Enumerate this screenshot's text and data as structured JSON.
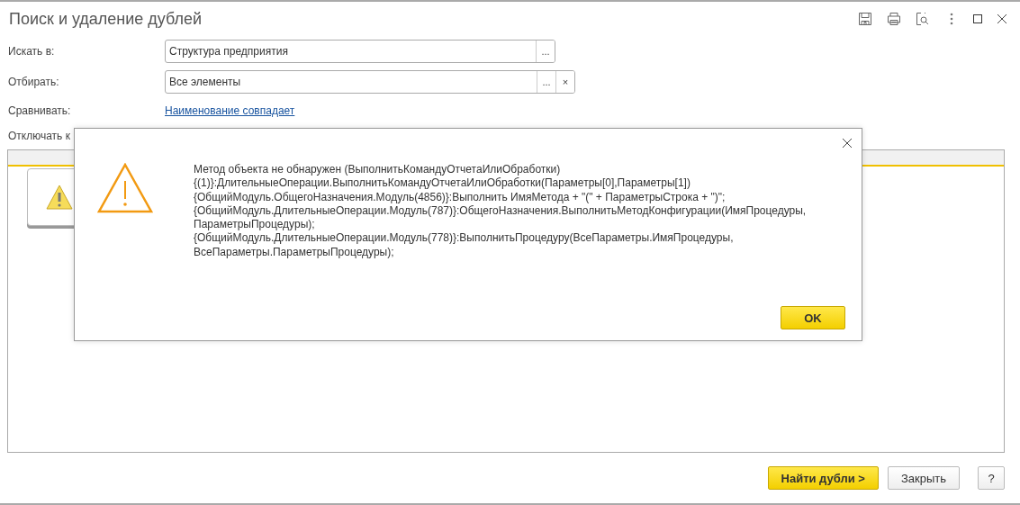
{
  "window": {
    "title": "Поиск и удаление дублей"
  },
  "fields": [
    {
      "label": "Искать в:",
      "value": "Структура предприятия",
      "buttons": [
        "..."
      ]
    },
    {
      "label": "Отбирать:",
      "value": "Все элементы",
      "buttons": [
        "...",
        "×"
      ]
    }
  ],
  "compare": {
    "label": "Сравнивать:",
    "link": "Наименование совпадает"
  },
  "disable": {
    "label": "Отключать к"
  },
  "buttons": [
    {
      "label": "Найти дубли >",
      "kind": "primary"
    },
    {
      "label": "Закрыть",
      "kind": "normal"
    },
    {
      "label": "?",
      "kind": "help"
    }
  ],
  "dialog": {
    "lines": [
      "Метод объекта не обнаружен (ВыполнитьКомандуОтчетаИлиОбработки)",
      "{(1)}:ДлительныеОперации.ВыполнитьКомандуОтчетаИлиОбработки(Параметры[0],Параметры[1])",
      "{ОбщийМодуль.ОбщегоНазначения.Модуль(4856)}:Выполнить ИмяМетода + \"(\" + ПараметрыСтрока + \")\";",
      "{ОбщийМодуль.ДлительныеОперации.Модуль(787)}:ОбщегоНазначения.ВыполнитьМетодКонфигурации(ИмяПроцедуры,",
      "ПараметрыПроцедуры);",
      "{ОбщийМодуль.ДлительныеОперации.Модуль(778)}:ВыполнитьПроцедуру(ВсеПараметры.ИмяПроцедуры,",
      "ВсеПараметры.ПараметрыПроцедуры);"
    ],
    "ok": "OK"
  }
}
